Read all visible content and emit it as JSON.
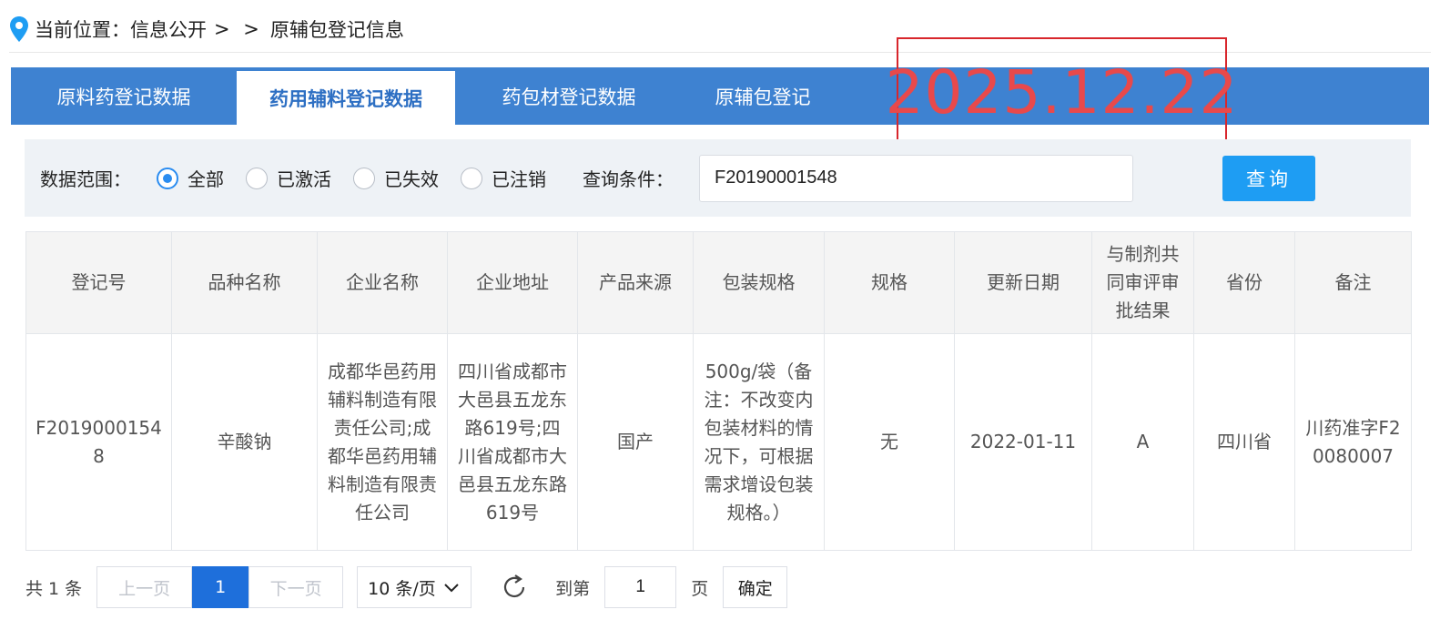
{
  "breadcrumb": {
    "prefix": "当前位置：",
    "section": "信息公开",
    "separator": "> >",
    "current": "原辅包登记信息"
  },
  "tabs": [
    {
      "label": "原料药登记数据",
      "active": false
    },
    {
      "label": "药用辅料登记数据",
      "active": true
    },
    {
      "label": "药包材登记数据",
      "active": false
    },
    {
      "label": "原辅包登记",
      "active": false
    }
  ],
  "stamp": {
    "date": "2025.12.22"
  },
  "filter": {
    "scope_label": "数据范围：",
    "options": [
      {
        "label": "全部",
        "checked": true
      },
      {
        "label": "已激活",
        "checked": false
      },
      {
        "label": "已失效",
        "checked": false
      },
      {
        "label": "已注销",
        "checked": false
      }
    ],
    "condition_label": "查询条件：",
    "query_value": "F20190001548",
    "search_label": "查询"
  },
  "table": {
    "headers": [
      "登记号",
      "品种名称",
      "企业名称",
      "企业地址",
      "产品来源",
      "包装规格",
      "规格",
      "更新日期",
      "与制剂共同审评审批结果",
      "省份",
      "备注"
    ],
    "rows": [
      [
        "F20190001548",
        "辛酸钠",
        "成都华邑药用辅料制造有限责任公司;成都华邑药用辅料制造有限责任公司",
        "四川省成都市大邑县五龙东路619号;四川省成都市大邑县五龙东路619号",
        "国产",
        "500g/袋（备注：不改变内包装材料的情况下，可根据需求增设包装规格。）",
        "无",
        "2022-01-11",
        "A",
        "四川省",
        "川药准字F20080007"
      ]
    ]
  },
  "pager": {
    "total": "共 1 条",
    "prev": "上一页",
    "page": "1",
    "next": "下一页",
    "page_size": "10 条/页",
    "goto_label": "到第",
    "goto_value": "1",
    "page_unit": "页",
    "confirm": "确定"
  },
  "colors": {
    "tabbar": "#3e82d1",
    "active_tab_text": "#2d6fc3",
    "primary_button": "#1e9df3",
    "current_page": "#1e6fdb",
    "stamp": "#d8262c"
  },
  "icons": {
    "breadcrumb": "location-pin-icon",
    "refresh": "refresh-icon",
    "dropdown": "chevron-down-icon"
  }
}
